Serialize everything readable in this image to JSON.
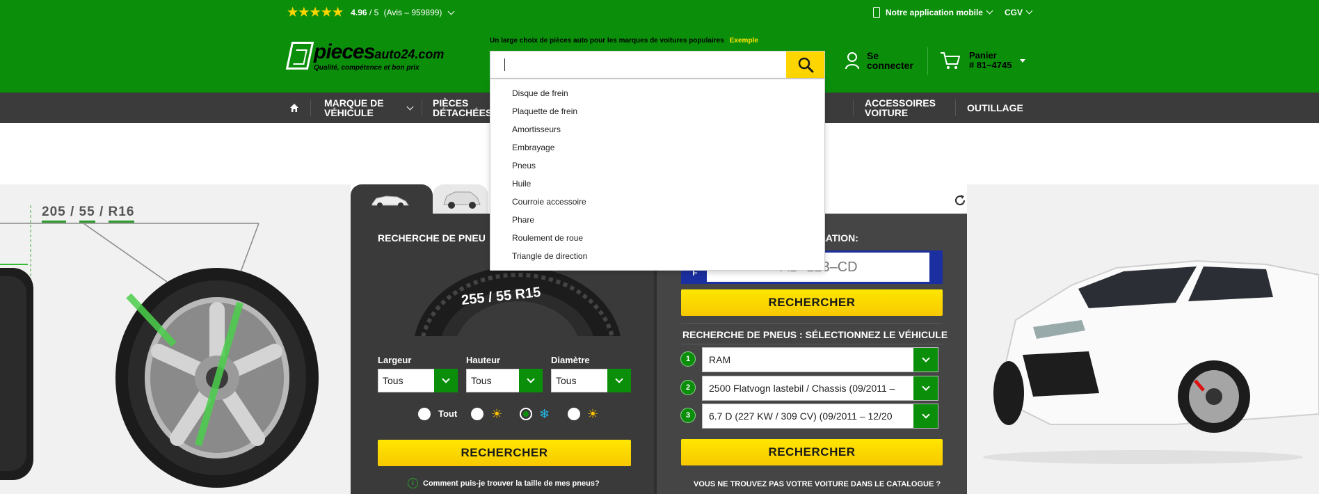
{
  "topbar": {
    "stars": "★★★★★",
    "rating_value": "4.96",
    "rating_scale": " / 5",
    "rating_reviews": "(Avis – 959899)",
    "app_label": "Notre application mobile",
    "cgv_label": "CGV"
  },
  "header": {
    "logo_big": "pieces",
    "logo_small": "auto24.com",
    "logo_tagline": "Qualité, compétence et bon prix",
    "search_hint": "Un large choix de pièces auto pour les marques de voitures populaires",
    "search_example": "Exemple",
    "search_value": "",
    "login_line1": "Se",
    "login_line2": "connecter",
    "cart_line1": "Panier",
    "cart_line2": "# 81–4745"
  },
  "nav": {
    "items": [
      {
        "line1": "MARQUE DE",
        "line2": "VÉHICULE"
      },
      {
        "line1": "PIÈCES",
        "line2": "DÉTACHÉES"
      },
      {
        "line1": "ACCESSOIRES",
        "line2": "VOITURE"
      },
      {
        "line1": "OUTILLAGE",
        "line2": ""
      }
    ]
  },
  "dropdown": {
    "items": [
      "Disque de frein",
      "Plaquette de frein",
      "Amortisseurs",
      "Embrayage",
      "Pneus",
      "Huile",
      "Courroie accessoire",
      "Phare",
      "Roulement de roue",
      "Triangle de direction"
    ]
  },
  "tire_illustration": {
    "size_a": "205",
    "sep1": " / ",
    "size_b": "55",
    "sep2": " / ",
    "size_c": "R16"
  },
  "tire_search": {
    "title": "RECHERCHE DE PNEU",
    "tire_size_text": "255 / 55  R15",
    "width_label": "Largeur",
    "width_value": "Tous",
    "height_label": "Hauteur",
    "height_value": "Tous",
    "diameter_label": "Diamètre",
    "diameter_value": "Tous",
    "season_all_label": "Tout",
    "season_summer_icon": "sun-icon",
    "season_winter_icon": "snowflake-icon",
    "season_allseason_icon": "sun-snow-icon",
    "search_button": "RECHERCHER",
    "help_text": "Comment puis-je trouver la taille de mes pneus?"
  },
  "plate_search": {
    "title_visible": "CULATION:",
    "country": "F",
    "plate_placeholder": "AB–123–CD",
    "search_button": "RECHERCHER"
  },
  "vehicle_search": {
    "title": "RECHERCHE DE PNEUS : SÉLECTIONNEZ LE VÉHICULE",
    "steps": [
      {
        "num": "1",
        "value": "RAM"
      },
      {
        "num": "2",
        "value": "2500 Flatvogn lastebil / Chassis (09/2011 –"
      },
      {
        "num": "3",
        "value": "6.7 D (227 KW / 309 CV) (09/2011 – 12/20"
      }
    ],
    "search_button": "RECHERCHER",
    "not_found_text": "VOUS NE TROUVEZ PAS VOTRE VOITURE DANS LE CATALOGUE ?"
  },
  "colors": {
    "brand_green": "#0b8f0b",
    "accent_yellow": "#ffd500",
    "nav_dark": "#3b3b3b"
  }
}
